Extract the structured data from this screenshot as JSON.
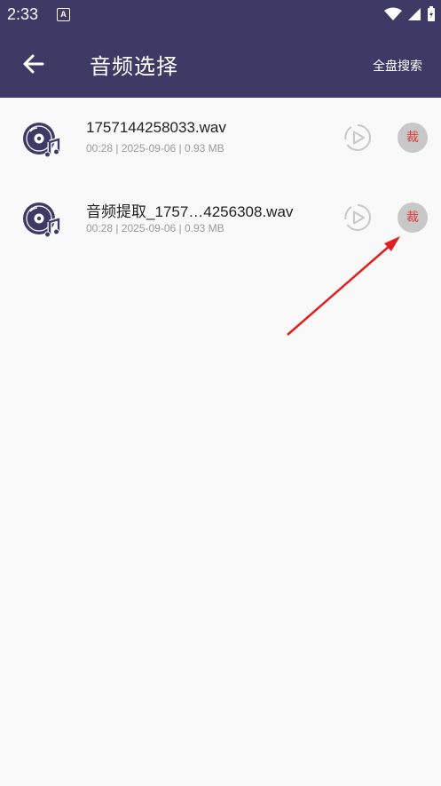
{
  "status_bar": {
    "time": "2:33",
    "a_badge": "A"
  },
  "app_bar": {
    "title": "音频选择",
    "search_label": "全盘搜索"
  },
  "files": [
    {
      "name": "1757144258033.wav",
      "meta": "00:28 | 2025-09-06 | 0.93 MB",
      "cut_label": "裁"
    },
    {
      "name": "音频提取_1757…4256308.wav",
      "meta": "00:28 | 2025-09-06 | 0.93 MB",
      "cut_label": "裁"
    }
  ],
  "colors": {
    "header": "#3e3a66",
    "accent_red": "#e23a3a",
    "icon": "#3e3a66"
  }
}
